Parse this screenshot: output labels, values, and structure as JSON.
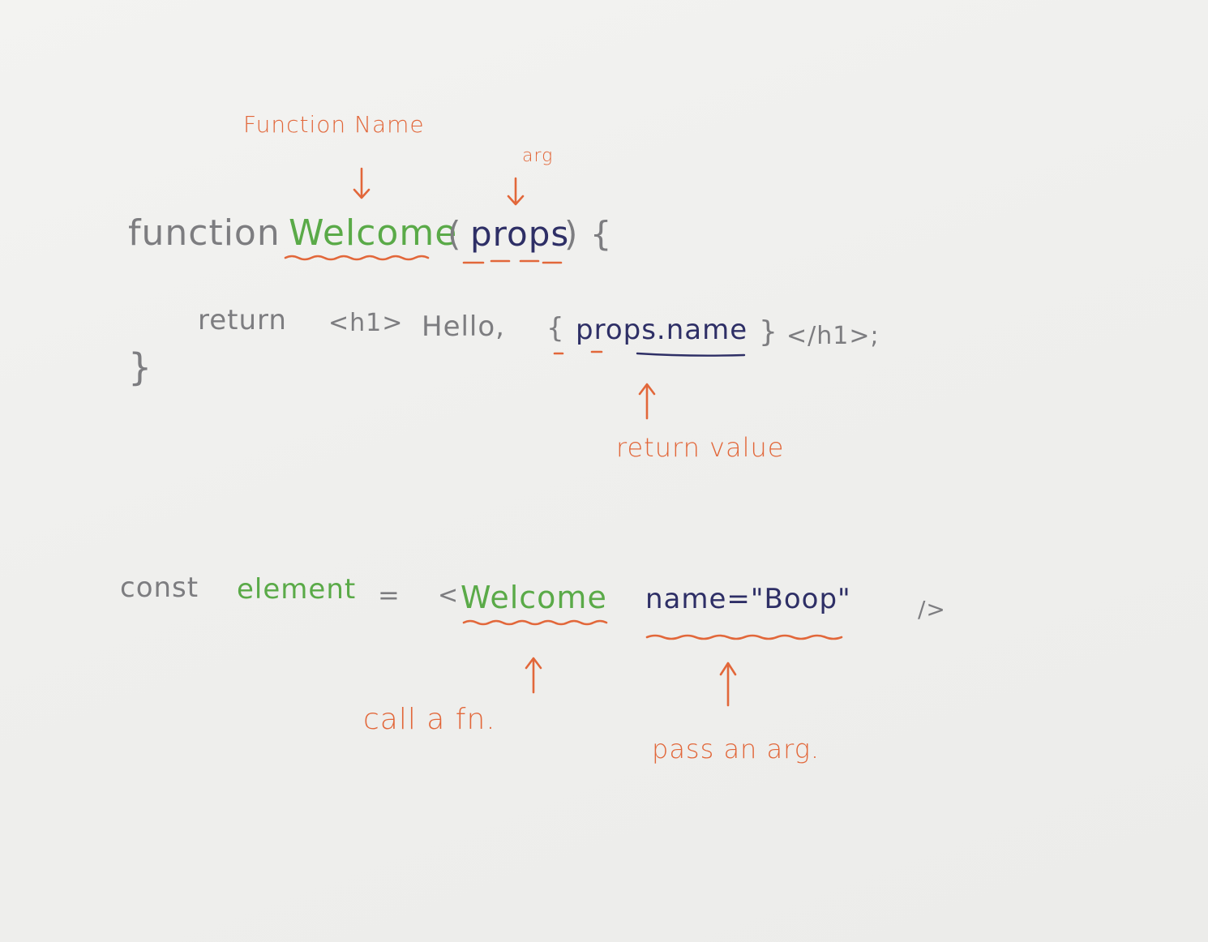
{
  "annotations": {
    "function_name": "Function Name",
    "arg": "arg",
    "return_value": "return value",
    "call_fn": "call a fn.",
    "pass_arg": "pass an arg."
  },
  "code": {
    "line1": {
      "keyword": "function",
      "name": "Welcome",
      "open_paren": "(",
      "param": "props",
      "close": ") {"
    },
    "line2": {
      "return_kw": "return",
      "open_tag": "<h1>",
      "hello": "Hello,",
      "open_brace": "{",
      "expr": "props.name",
      "close_brace": "}",
      "close_tag": "</h1>;"
    },
    "line3": {
      "brace": "}"
    },
    "line4": {
      "const_kw": "const",
      "var_name": "element",
      "equals": "=",
      "lt": "<",
      "component": "Welcome",
      "attr": "name=\"Boop\"",
      "self_close": "/>"
    }
  },
  "colors": {
    "orange": "#e2673a",
    "gray": "#7d7d80",
    "green": "#5aaa48",
    "navy": "#2e2f66",
    "paper": "#efefed"
  }
}
